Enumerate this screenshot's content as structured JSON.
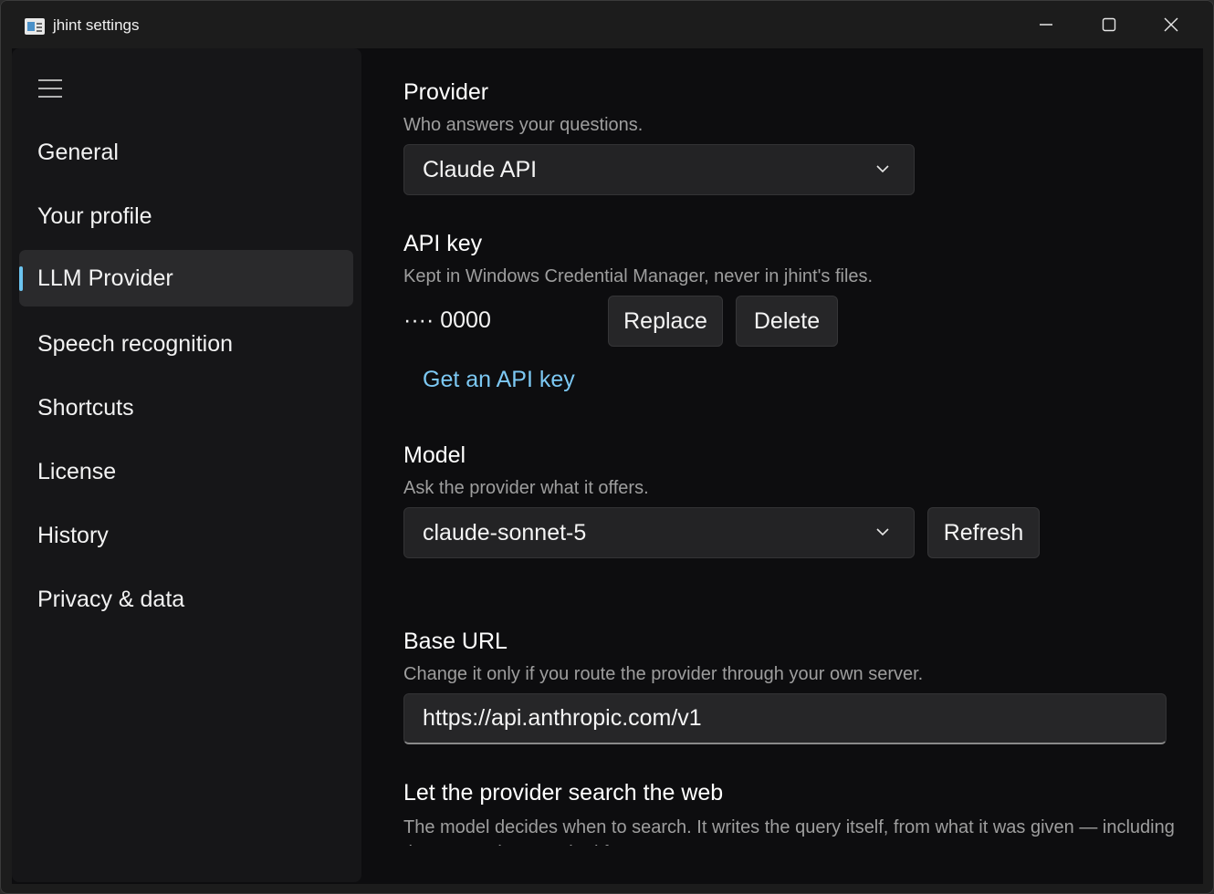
{
  "window": {
    "title": "jhint settings",
    "minimize_icon": "minimize-icon",
    "maximize_icon": "maximize-icon",
    "close_icon": "close-icon"
  },
  "nav": {
    "menu_icon": "hamburger-menu-icon",
    "items": [
      {
        "label": "General",
        "active": false
      },
      {
        "label": "Your profile",
        "active": false
      },
      {
        "label": "LLM Provider",
        "active": true
      },
      {
        "label": "Speech recognition",
        "active": false
      },
      {
        "label": "Shortcuts",
        "active": false
      },
      {
        "label": "License",
        "active": false
      },
      {
        "label": "History",
        "active": false
      },
      {
        "label": "Privacy & data",
        "active": false
      }
    ],
    "accent_color": "#6cc4f0"
  },
  "provider": {
    "title": "Provider",
    "description": "Who answers your questions.",
    "selected": "Claude API"
  },
  "api_key": {
    "title": "API key",
    "description": "Kept in Windows Credential Manager, never in jhint's files.",
    "masked_value": "···· 0000",
    "replace_label": "Replace",
    "delete_label": "Delete",
    "link_label": "Get an API key",
    "link_color": "#7cc8f3"
  },
  "model": {
    "title": "Model",
    "description": "Ask the provider what it offers.",
    "selected": "claude-sonnet-5",
    "refresh_label": "Refresh"
  },
  "base_url": {
    "title": "Base URL",
    "description": "Change it only if you route the provider through your own server.",
    "value": "https://api.anthropic.com/v1"
  },
  "web_search": {
    "title": "Let the provider search the web",
    "description": "The model decides when to search. It writes the query itself, from what it was given — including the context it was asked for"
  }
}
